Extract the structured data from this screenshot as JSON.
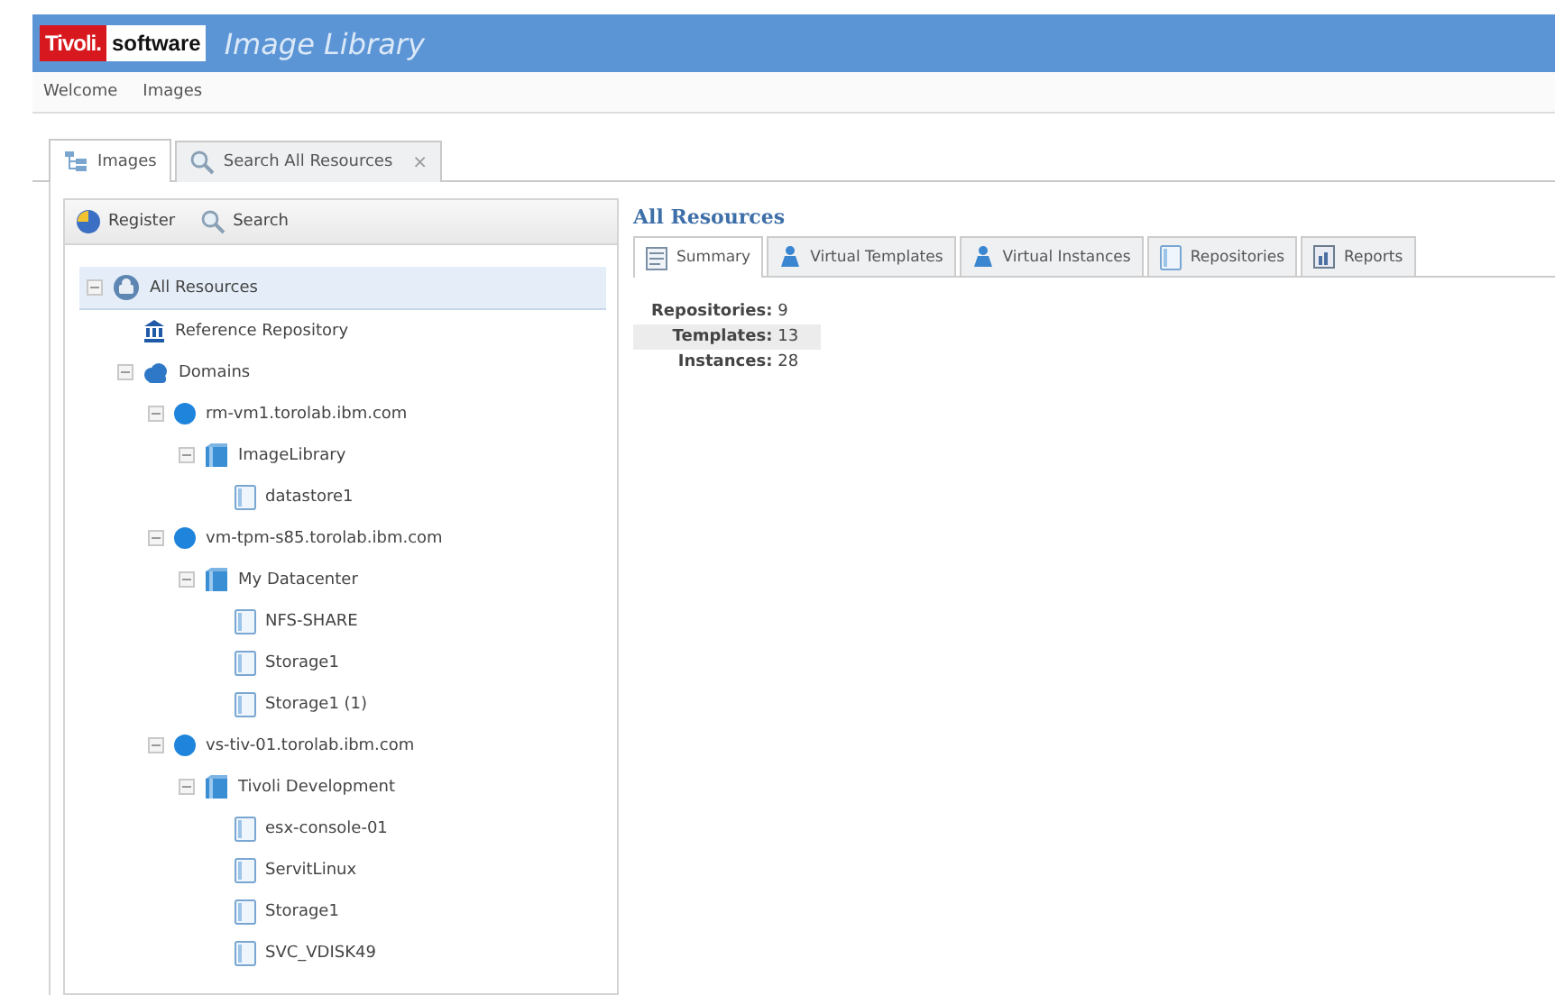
{
  "header": {
    "brand_red": "Tivoli.",
    "brand_white": "software",
    "title": "Image Library"
  },
  "nav": [
    "Welcome",
    "Images"
  ],
  "tabs": [
    {
      "label": "Images",
      "kind": "tree",
      "selected": true
    },
    {
      "label": "Search All Resources",
      "kind": "search",
      "selected": false,
      "close": "×"
    }
  ],
  "toolbar": [
    {
      "label": "Register",
      "kind": "register"
    },
    {
      "label": "Search",
      "kind": "search"
    }
  ],
  "tree": [
    {
      "label": "All Resources",
      "kind": "root",
      "expanded": true,
      "selected": true,
      "children": [
        {
          "label": "Reference Repository",
          "kind": "repository",
          "selected": false
        },
        {
          "label": "Domains",
          "kind": "domains",
          "expanded": true,
          "selected": false,
          "children": [
            {
              "label": "rm-vm1.torolab.ibm.com",
              "kind": "host",
              "expanded": true,
              "selected": false,
              "children": [
                {
                  "label": "ImageLibrary",
                  "kind": "datacenter",
                  "expanded": true,
                  "selected": false,
                  "children": [
                    {
                      "label": "datastore1",
                      "kind": "datastore",
                      "selected": false
                    }
                  ]
                }
              ]
            },
            {
              "label": "vm-tpm-s85.torolab.ibm.com",
              "kind": "host",
              "expanded": true,
              "selected": false,
              "children": [
                {
                  "label": "My Datacenter",
                  "kind": "datacenter",
                  "expanded": true,
                  "selected": false,
                  "children": [
                    {
                      "label": "NFS-SHARE",
                      "kind": "datastore",
                      "selected": false
                    },
                    {
                      "label": "Storage1",
                      "kind": "datastore",
                      "selected": false
                    },
                    {
                      "label": "Storage1 (1)",
                      "kind": "datastore",
                      "selected": false
                    }
                  ]
                }
              ]
            },
            {
              "label": "vs-tiv-01.torolab.ibm.com",
              "kind": "host",
              "expanded": true,
              "selected": false,
              "children": [
                {
                  "label": "Tivoli Development",
                  "kind": "datacenter",
                  "expanded": true,
                  "selected": false,
                  "children": [
                    {
                      "label": "esx-console-01",
                      "kind": "datastore",
                      "selected": false
                    },
                    {
                      "label": "ServitLinux",
                      "kind": "datastore",
                      "selected": false
                    },
                    {
                      "label": "Storage1",
                      "kind": "datastore",
                      "selected": false
                    },
                    {
                      "label": "SVC_VDISK49",
                      "kind": "datastore",
                      "selected": false
                    }
                  ]
                }
              ]
            }
          ]
        }
      ]
    }
  ],
  "detail": {
    "title": "All Resources",
    "tabs": [
      {
        "label": "Summary",
        "kind": "summary",
        "selected": true
      },
      {
        "label": "Virtual Templates",
        "kind": "vm",
        "selected": false
      },
      {
        "label": "Virtual Instances",
        "kind": "vm",
        "selected": false
      },
      {
        "label": "Repositories",
        "kind": "datastore",
        "selected": false
      },
      {
        "label": "Reports",
        "kind": "report",
        "selected": false
      }
    ],
    "summary": [
      {
        "label": "Repositories:",
        "value": "9",
        "highlighted": false
      },
      {
        "label": "Templates:",
        "value": "13",
        "highlighted": true
      },
      {
        "label": "Instances:",
        "value": "28",
        "highlighted": false
      }
    ]
  }
}
